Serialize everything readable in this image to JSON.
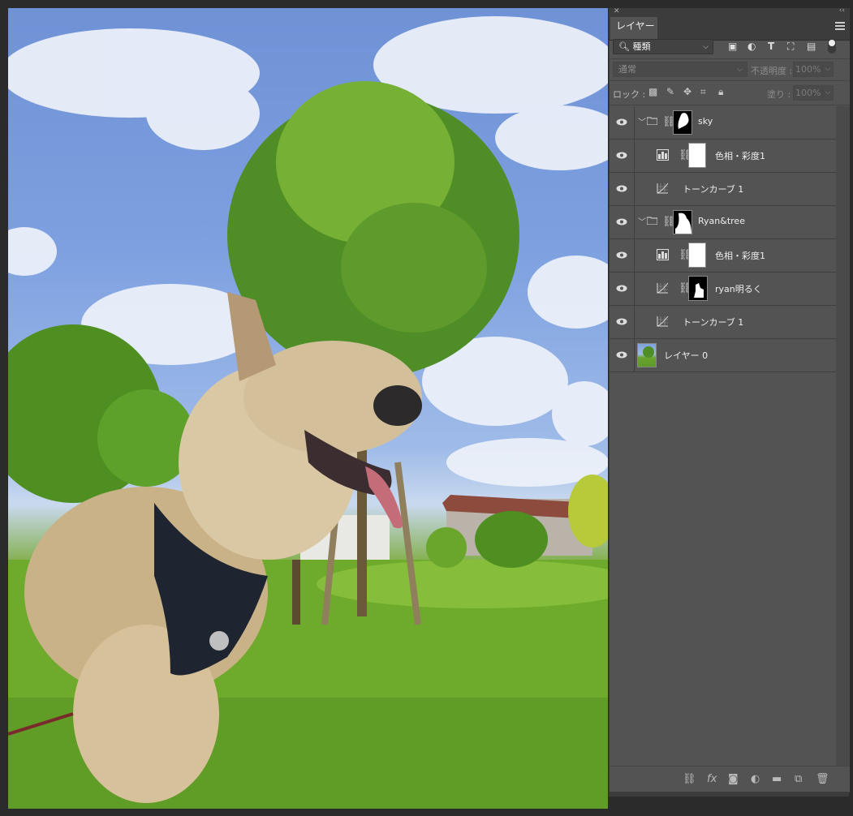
{
  "panel": {
    "tab_label": "レイヤー",
    "filter": {
      "label": "種類",
      "icons": [
        "image-filter-icon",
        "adjustment-filter-icon",
        "type-filter-icon",
        "shape-filter-icon",
        "smart-object-filter-icon"
      ]
    },
    "blend_mode": "通常",
    "opacity_label": "不透明度 :",
    "opacity_value": "100%",
    "lock_label": "ロック :",
    "fill_label": "塗り :",
    "fill_value": "100%",
    "layers": [
      {
        "name": "sky",
        "type": "group",
        "mask": "black-with-white"
      },
      {
        "name": "色相・彩度1",
        "type": "hue-saturation",
        "mask": "white"
      },
      {
        "name": "トーンカーブ 1",
        "type": "curves",
        "mask": "none"
      },
      {
        "name": "Ryan&tree",
        "type": "group",
        "mask": "black-with-white"
      },
      {
        "name": "色相・彩度1",
        "type": "hue-saturation",
        "mask": "white"
      },
      {
        "name": "ryan明るく",
        "type": "curves",
        "mask": "black-with-white"
      },
      {
        "name": "トーンカーブ 1",
        "type": "curves",
        "mask": "none"
      },
      {
        "name": "レイヤー 0",
        "type": "pixel",
        "mask": "none"
      }
    ],
    "bottom_icons": [
      "link-layers-icon",
      "fx-icon",
      "add-mask-icon",
      "adjustment-layer-icon",
      "new-group-icon",
      "new-layer-icon",
      "delete-icon"
    ],
    "fx_glyph": "fx"
  },
  "colors": {
    "panel_bg": "#535353",
    "panel_dark": "#3c3c3c",
    "app_bg": "#2b2b2b"
  }
}
